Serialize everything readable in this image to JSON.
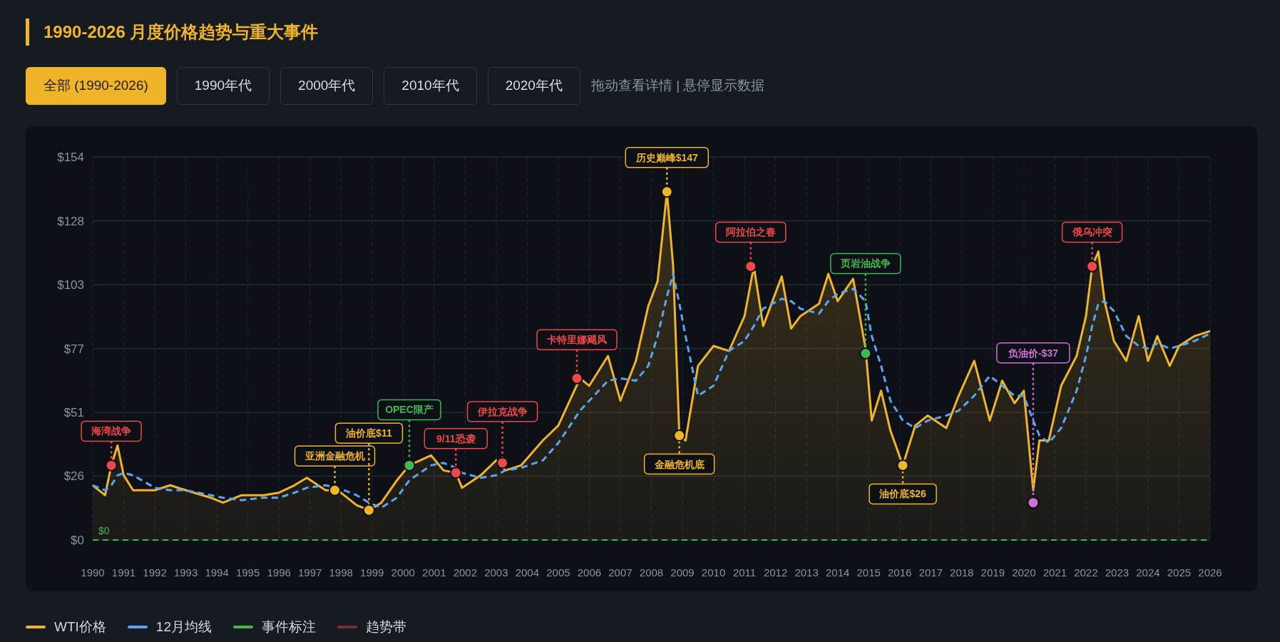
{
  "title": "1990-2026 月度价格趋势与重大事件",
  "filters": [
    {
      "label": "全部 (1990-2026)",
      "selected": true
    },
    {
      "label": "1990年代",
      "selected": false
    },
    {
      "label": "2000年代",
      "selected": false
    },
    {
      "label": "2010年代",
      "selected": false
    },
    {
      "label": "2020年代",
      "selected": false
    }
  ],
  "hint": "拖动查看详情 | 悬停显示数据",
  "chart": {
    "chart_data": {
      "type": "area",
      "grid": true,
      "x": [
        1990.0,
        1990.4,
        1990.6,
        1990.8,
        1991.0,
        1991.3,
        1992.0,
        1992.5,
        1993.0,
        1993.8,
        1994.2,
        1994.8,
        1995.5,
        1996.0,
        1996.5,
        1996.9,
        1997.5,
        1997.9,
        1998.5,
        1998.9,
        1999.3,
        1999.8,
        2000.2,
        2000.9,
        2001.3,
        2001.7,
        2001.9,
        2002.5,
        2003.0,
        2003.3,
        2003.8,
        2004.5,
        2005.0,
        2005.7,
        2006.0,
        2006.6,
        2007.0,
        2007.5,
        2007.9,
        2008.2,
        2008.5,
        2008.7,
        2008.9,
        2009.1,
        2009.5,
        2010.0,
        2010.5,
        2011.0,
        2011.3,
        2011.6,
        2012.2,
        2012.5,
        2012.8,
        2013.4,
        2013.7,
        2014.0,
        2014.5,
        2014.9,
        2015.1,
        2015.4,
        2015.7,
        2016.1,
        2016.5,
        2016.9,
        2017.5,
        2017.9,
        2018.4,
        2018.9,
        2019.3,
        2019.7,
        2020.0,
        2020.3,
        2020.5,
        2020.8,
        2021.2,
        2021.7,
        2022.0,
        2022.2,
        2022.4,
        2022.6,
        2022.9,
        2023.3,
        2023.7,
        2024.0,
        2024.3,
        2024.7,
        2025.0,
        2025.5,
        2026.0
      ],
      "series": [
        {
          "name": "WTI价格",
          "color": "#f0b429",
          "values": [
            22,
            18,
            30,
            38,
            26,
            20,
            20,
            22,
            20,
            17,
            15,
            18,
            18,
            19,
            22,
            25,
            20,
            20,
            14,
            12,
            15,
            24,
            30,
            34,
            28,
            27,
            21,
            26,
            32,
            28,
            30,
            40,
            46,
            65,
            62,
            74,
            56,
            72,
            94,
            104,
            140,
            110,
            42,
            40,
            70,
            78,
            76,
            90,
            110,
            86,
            106,
            85,
            90,
            95,
            107,
            96,
            105,
            77,
            48,
            60,
            44,
            30,
            46,
            50,
            45,
            58,
            72,
            48,
            64,
            55,
            60,
            20,
            40,
            40,
            62,
            74,
            90,
            110,
            116,
            96,
            80,
            72,
            90,
            72,
            82,
            70,
            78,
            82,
            84
          ]
        },
        {
          "name": "12月均线",
          "color": "#58a6f0",
          "type": "line",
          "line_style": "dashed",
          "values": [
            22,
            20,
            22,
            26,
            27,
            26,
            21,
            20,
            20,
            18,
            17,
            16,
            17,
            17,
            19,
            21,
            22,
            21,
            18,
            15,
            13,
            17,
            24,
            30,
            31,
            29,
            27,
            25,
            26,
            28,
            29,
            32,
            39,
            52,
            56,
            64,
            65,
            64,
            70,
            82,
            98,
            107,
            95,
            82,
            58,
            62,
            76,
            80,
            86,
            93,
            97,
            96,
            93,
            91,
            96,
            99,
            101,
            96,
            82,
            70,
            56,
            48,
            45,
            48,
            50,
            52,
            58,
            66,
            62,
            58,
            58,
            48,
            42,
            39,
            45,
            60,
            74,
            86,
            95,
            96,
            92,
            82,
            78,
            77,
            79,
            77,
            78,
            80,
            83
          ]
        }
      ],
      "xlim": [
        1990,
        2026
      ],
      "ylim": [
        0,
        154
      ],
      "xticks": [
        1990,
        1991,
        1992,
        1993,
        1994,
        1995,
        1996,
        1997,
        1998,
        1999,
        2000,
        2001,
        2002,
        2003,
        2004,
        2005,
        2006,
        2007,
        2008,
        2009,
        2010,
        2011,
        2012,
        2013,
        2014,
        2015,
        2016,
        2017,
        2018,
        2019,
        2020,
        2021,
        2022,
        2023,
        2024,
        2025,
        2026
      ],
      "yticks": [
        {
          "value": 0,
          "label": "$0"
        },
        {
          "value": 25.67,
          "label": "$26"
        },
        {
          "value": 51.33,
          "label": "$51"
        },
        {
          "value": 77,
          "label": "$77"
        },
        {
          "value": 102.67,
          "label": "$103"
        },
        {
          "value": 128.33,
          "label": "$128"
        },
        {
          "value": 154,
          "label": "$154"
        }
      ],
      "annotations": [
        "$0",
        {
          "text": "海湾战争",
          "x": 1990.6,
          "y": 30
        },
        {
          "text": "亚洲金融危机",
          "x": 1997.8,
          "y": 20
        },
        {
          "text": "油价底$11",
          "x": 1998.9,
          "y": 12
        },
        {
          "text": "OPEC限产",
          "x": 2000.2,
          "y": 30
        },
        {
          "text": "9/11恐袭",
          "x": 2001.7,
          "y": 27
        },
        {
          "text": "伊拉克战争",
          "x": 2003.2,
          "y": 31
        },
        {
          "text": "卡特里娜飓风",
          "x": 2005.6,
          "y": 65
        },
        {
          "text": "历史巅峰$147",
          "x": 2008.5,
          "y": 140
        },
        {
          "text": "金融危机底",
          "x": 2008.9,
          "y": 42
        },
        {
          "text": "阿拉伯之春",
          "x": 2011.2,
          "y": 110
        },
        {
          "text": "页岩油战争",
          "x": 2014.9,
          "y": 75
        },
        {
          "text": "油价底$26",
          "x": 2016.1,
          "y": 30
        },
        {
          "text": "负油价-$37",
          "x": 2020.3,
          "y": 15
        },
        {
          "text": "俄乌冲突",
          "x": 2022.2,
          "y": 110
        }
      ]
    },
    "annotation_styles": [
      {
        "color": "#3fb950"
      },
      {
        "color": "#f04848"
      },
      {
        "color": "#f0b429"
      },
      {
        "color": "#f0b429"
      },
      {
        "color": "#3fb950"
      },
      {
        "color": "#f04848"
      },
      {
        "color": "#f04848"
      },
      {
        "color": "#f04848"
      },
      {
        "color": "#f0b429"
      },
      {
        "color": "#f0b429"
      },
      {
        "color": "#f04848"
      },
      {
        "color": "#3fb950"
      },
      {
        "color": "#f0b429"
      },
      {
        "color": "#d070d8"
      },
      {
        "color": "#f04848"
      }
    ]
  },
  "legend": [
    {
      "label": "事件标注",
      "color": "#3fb950"
    },
    {
      "label": "趋势带",
      "color": "#7a2e2e"
    }
  ]
}
